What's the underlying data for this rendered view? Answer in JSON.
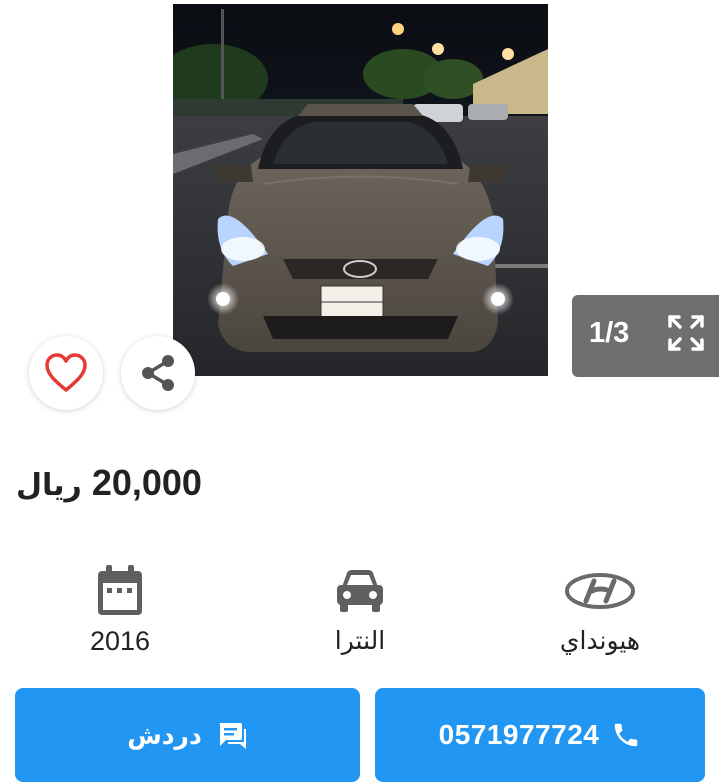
{
  "gallery": {
    "photo_alt": "car photo",
    "counter": "1/3",
    "prev_icon": "chevron-left-icon",
    "next_icon": "chevron-right-icon",
    "expand_icon": "fullscreen-icon"
  },
  "listing": {
    "price_amount": "20,000",
    "price_currency": "ريال"
  },
  "specs": {
    "year": "2016",
    "model": "النترا",
    "brand": "هيونداي"
  },
  "actions": {
    "chat_label": "دردش",
    "call_label": "0571977724"
  },
  "colors": {
    "accent": "#2196f3",
    "counter_bg": "#6f6f6f",
    "heart": "#e53935"
  }
}
